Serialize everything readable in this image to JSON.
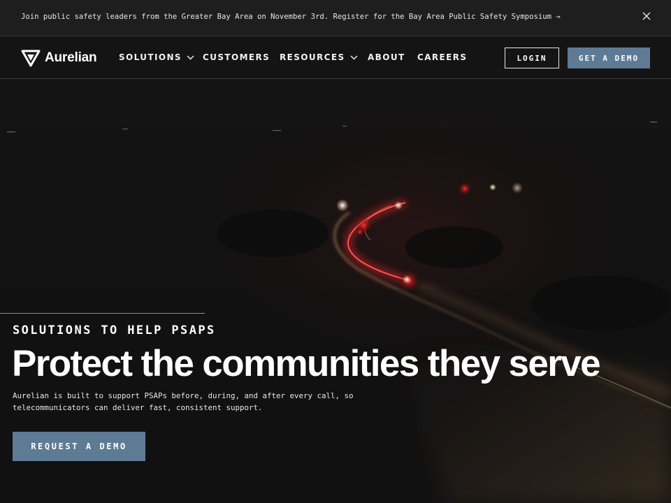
{
  "announcement": {
    "text": "Join public safety leaders from the Greater Bay Area on November 3rd. Register for the Bay Area Public Safety Symposium →",
    "close_icon": "close-icon"
  },
  "nav": {
    "logo_text": "Aurelian",
    "items": [
      {
        "label": "SOLUTIONS",
        "has_dropdown": true
      },
      {
        "label": "CUSTOMERS",
        "has_dropdown": false
      },
      {
        "label": "RESOURCES",
        "has_dropdown": true
      },
      {
        "label": "ABOUT",
        "has_dropdown": false
      },
      {
        "label": "CAREERS",
        "has_dropdown": false
      }
    ],
    "login_label": "LOGIN",
    "demo_label": "GET A DEMO"
  },
  "hero": {
    "eyebrow": "SOLUTIONS TO HELP PSAPS",
    "title": "Protect the communities they serve",
    "description_line1": "Aurelian is built to support PSAPs before, during, and after every call, so",
    "description_line2": "telecommunicators can deliver fast, consistent support.",
    "cta_label": "REQUEST A DEMO"
  },
  "colors": {
    "accent": "#5e7b96",
    "background": "#141414",
    "announcement_bg": "#1e1e1e"
  }
}
